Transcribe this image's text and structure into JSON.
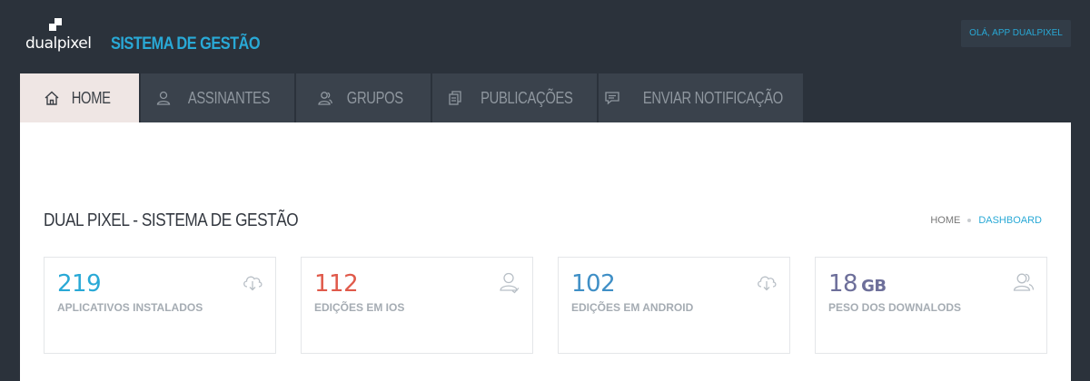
{
  "brand": {
    "logo_text": "dualpixel",
    "app_title": "SISTEMA DE GESTÃO"
  },
  "user": {
    "greeting": "OLÁ, APP DUALPIXEL"
  },
  "nav": {
    "tabs": [
      {
        "label": "HOME",
        "icon": "home-icon",
        "active": true
      },
      {
        "label": "ASSINANTES",
        "icon": "user-icon",
        "active": false
      },
      {
        "label": "GRUPOS",
        "icon": "group-icon",
        "active": false
      },
      {
        "label": "PUBLICAÇÕES",
        "icon": "publications-icon",
        "active": false
      },
      {
        "label": "ENVIAR NOTIFICAÇÃO",
        "icon": "message-icon",
        "active": false
      }
    ]
  },
  "page": {
    "title": "DUAL PIXEL - SISTEMA DE GESTÃO",
    "breadcrumb": [
      "HOME",
      "DASHBOARD"
    ]
  },
  "stats": [
    {
      "value": "219",
      "unit": "",
      "label": "APLICATIVOS INSTALADOS",
      "icon": "cloud-download-icon",
      "color": "#29a9d6"
    },
    {
      "value": "112",
      "unit": "",
      "label": "EDIÇÕES EM IOS",
      "icon": "user-check-icon",
      "color": "#e05a4b"
    },
    {
      "value": "102",
      "unit": "",
      "label": "EDIÇÕES EM ANDROID",
      "icon": "cloud-download-icon",
      "color": "#3f8fc6"
    },
    {
      "value": "18",
      "unit": "GB",
      "label": "PESO DOS DOWNALODS",
      "icon": "users-icon",
      "color": "#6d6f9a"
    }
  ],
  "colors": {
    "accent": "#29a9d6",
    "background": "#2b323b",
    "tab_inactive": "#3a424c",
    "tab_active": "#efe6e4"
  }
}
